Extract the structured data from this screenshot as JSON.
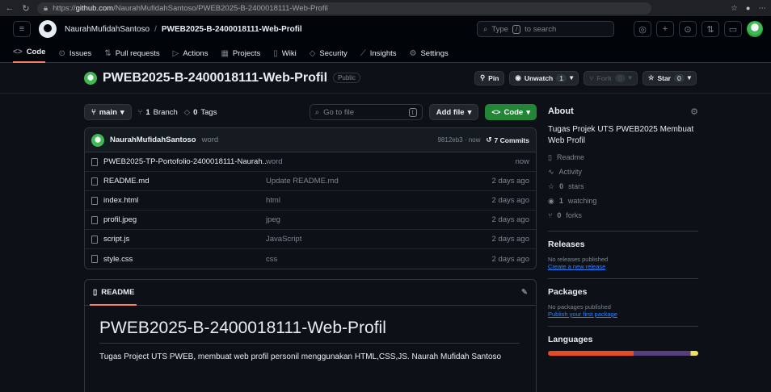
{
  "browser": {
    "url_prefix": "https://",
    "url_host": "github.com",
    "url_path": "/NaurahMufidahSantoso/PWEB2025-B-2400018111-Web-Profil"
  },
  "header": {
    "owner": "NaurahMufidahSantoso",
    "separator": "/",
    "repo": "PWEB2025-B-2400018111-Web-Profil",
    "search_text_before": "Type",
    "search_key": "/",
    "search_text_after": "to search"
  },
  "tabs": [
    {
      "label": "Code",
      "icon": "code-icon",
      "glyph": "<>"
    },
    {
      "label": "Issues",
      "icon": "issue-icon",
      "glyph": "⊙"
    },
    {
      "label": "Pull requests",
      "icon": "pr-icon",
      "glyph": "⇅"
    },
    {
      "label": "Actions",
      "icon": "play-icon",
      "glyph": "▷"
    },
    {
      "label": "Projects",
      "icon": "table-icon",
      "glyph": "▦"
    },
    {
      "label": "Wiki",
      "icon": "book-icon",
      "glyph": "▯"
    },
    {
      "label": "Security",
      "icon": "shield-icon",
      "glyph": "◇"
    },
    {
      "label": "Insights",
      "icon": "graph-icon",
      "glyph": "⟋"
    },
    {
      "label": "Settings",
      "icon": "gear-icon",
      "glyph": "⚙"
    }
  ],
  "repo": {
    "title": "PWEB2025-B-2400018111-Web-Profil",
    "visibility": "Public",
    "pin": "Pin",
    "watch": "Unwatch",
    "watch_count": "1",
    "fork": "Fork",
    "fork_count": "0",
    "star": "Star",
    "star_count": "0"
  },
  "filebar": {
    "branch": "main",
    "branches_count": "1",
    "branches_label": "Branch",
    "tags_count": "0",
    "tags_label": "Tags",
    "goto_placeholder": "Go to file",
    "goto_key": "t",
    "add_file": "Add file",
    "code": "Code"
  },
  "commit": {
    "author": "NaurahMufidahSantoso",
    "message": "word",
    "meta": "9812eb3 · now",
    "commits": "7 Commits"
  },
  "files": [
    {
      "name": "PWEB2025-TP-Portofolio-2400018111-Naurah...",
      "message": "word",
      "date": "now"
    },
    {
      "name": "README.md",
      "message": "Update README.md",
      "date": "2 days ago"
    },
    {
      "name": "index.html",
      "message": "html",
      "date": "2 days ago"
    },
    {
      "name": "profil.jpeg",
      "message": "jpeg",
      "date": "2 days ago"
    },
    {
      "name": "script.js",
      "message": "JavaScript",
      "date": "2 days ago"
    },
    {
      "name": "style.css",
      "message": "css",
      "date": "2 days ago"
    }
  ],
  "readme": {
    "tab": "README",
    "heading": "PWEB2025-B-2400018111-Web-Profil",
    "body": "Tugas Project UTS PWEB, membuat web profil personil menggunakan HTML,CSS,JS. Naurah Mufidah Santoso"
  },
  "about": {
    "title": "About",
    "description": "Tugas Projek UTS PWEB2025 Membuat Web Profil",
    "readme": "Readme",
    "activity": "Activity",
    "stars": "0",
    "stars_label": "stars",
    "watching": "1",
    "watching_label": "watching",
    "forks": "0",
    "forks_label": "forks"
  },
  "releases": {
    "title": "Releases",
    "text": "No releases published",
    "link": "Create a new release"
  },
  "packages": {
    "title": "Packages",
    "text": "No packages published",
    "link": "Publish your first package"
  },
  "languages": {
    "title": "Languages"
  },
  "colors": {
    "background": "#0d1117",
    "accent_green": "#238636",
    "tab_underline": "#f78166",
    "link": "#2f81f7"
  }
}
